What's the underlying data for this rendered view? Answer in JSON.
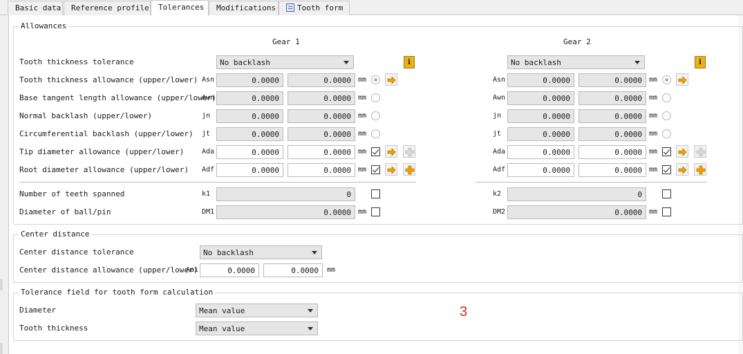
{
  "tabs": [
    {
      "label": "Basic data"
    },
    {
      "label": "Reference profile"
    },
    {
      "label": "Tolerances"
    },
    {
      "label": "Modifications"
    },
    {
      "label": "Tooth form"
    }
  ],
  "allowances": {
    "title": "Allowances",
    "gear1_header": "Gear 1",
    "gear2_header": "Gear 2",
    "tooth_thickness_tolerance_label": "Tooth thickness tolerance",
    "gear1_tolerance_value": "No backlash",
    "gear2_tolerance_value": "No backlash",
    "unit": "mm",
    "rows": [
      {
        "label": "Tooth thickness allowance (upper/lower)",
        "sym": "Asn",
        "g1_upper": "0.0000",
        "g1_lower": "0.0000",
        "g2_upper": "0.0000",
        "g2_lower": "0.0000"
      },
      {
        "label": "Base tangent length allowance (upper/lower)",
        "sym": "Awn",
        "g1_upper": "0.0000",
        "g1_lower": "0.0000",
        "g2_upper": "0.0000",
        "g2_lower": "0.0000"
      },
      {
        "label": "Normal backlash (upper/lower)",
        "sym": "jn",
        "g1_upper": "0.0000",
        "g1_lower": "0.0000",
        "g2_upper": "0.0000",
        "g2_lower": "0.0000"
      },
      {
        "label": "Circumferential backlash (upper/lower)",
        "sym": "jt",
        "g1_upper": "0.0000",
        "g1_lower": "0.0000",
        "g2_upper": "0.0000",
        "g2_lower": "0.0000"
      },
      {
        "label": "Tip diameter allowance (upper/lower)",
        "sym": "Ada",
        "g1_upper": "0.0000",
        "g1_lower": "0.0000",
        "g2_upper": "0.0000",
        "g2_lower": "0.0000"
      },
      {
        "label": "Root diameter allowance (upper/lower)",
        "sym": "Adf",
        "g1_upper": "0.0000",
        "g1_lower": "0.0000",
        "g2_upper": "0.0000",
        "g2_lower": "0.0000"
      }
    ],
    "teeth_spanned_label": "Number of teeth spanned",
    "teeth_spanned_sym1": "k1",
    "teeth_spanned_sym2": "k2",
    "teeth_spanned_g1": "0",
    "teeth_spanned_g2": "0",
    "ball_pin_label": "Diameter of ball/pin",
    "ball_pin_sym1": "DM1",
    "ball_pin_sym2": "DM2",
    "ball_pin_g1": "0.0000",
    "ball_pin_g2": "0.0000"
  },
  "center_distance": {
    "title": "Center distance",
    "tolerance_label": "Center distance tolerance",
    "tolerance_value": "No backlash",
    "allowance_label": "Center distance allowance (upper/lower)",
    "allowance_sym": "Aai",
    "upper": "0.0000",
    "lower": "0.0000",
    "unit": "mm"
  },
  "tolerance_field": {
    "title": "Tolerance field for tooth form calculation",
    "diameter_label": "Diameter",
    "diameter_value": "Mean value",
    "thickness_label": "Tooth thickness",
    "thickness_value": "Mean value"
  },
  "annotation": "3",
  "colors": {
    "accent_red": "#e0231b",
    "info_yellow": "#e8b318",
    "arrow_orange": "#f0a000"
  }
}
